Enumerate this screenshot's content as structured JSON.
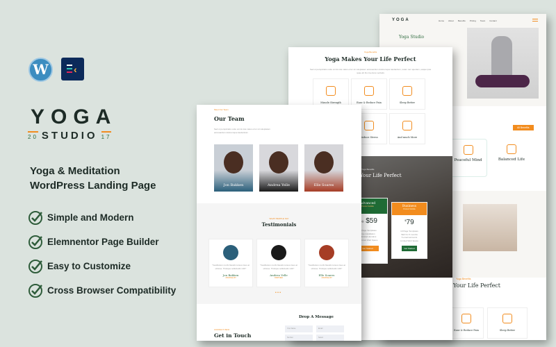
{
  "badges": {
    "wordpress_icon": "wordpress-logo",
    "elementor_icon": "elementor-kit-logo"
  },
  "logo": {
    "word": "YOGA",
    "sub": "STUDIO",
    "left": "20",
    "right": "17"
  },
  "headline": {
    "line1": "Yoga & Meditation",
    "line2": "WordPress Landing Page"
  },
  "features": [
    "Simple and Modern",
    "Elemnentor Page Builder",
    "Easy to Customize",
    "Cross Browser Compatibility"
  ],
  "colors": {
    "accent": "#f28c1e",
    "brand_green": "#2e6b3e",
    "background": "#dbe3de",
    "text_dark": "#1d2b26"
  },
  "back_page": {
    "logo": "YOGA",
    "nav": [
      "Home",
      "About",
      "Benefits",
      "Pricing",
      "Team",
      "Contact"
    ],
    "hero_title": "Yoga Studio",
    "benefits_btn": "All Benefits",
    "cards": [
      {
        "title": "Peaceful Mind"
      },
      {
        "title": "Balanced Life"
      }
    ],
    "section_label": "Yoga Benefits",
    "section_title": "Your Life Perfect",
    "items": [
      "Ease & Reduce Pain",
      "Sleep Better"
    ]
  },
  "middle_page": {
    "label": "Yoga Benefits",
    "title": "Yoga Makes Your Life Perfect",
    "items": [
      "Muscle Strength",
      "Ease & Reduce Pain",
      "Sleep Better",
      "Reduce Stress",
      "And much More"
    ],
    "pricing": {
      "label": "Yoga Benefits",
      "title": "Your Life Perfect",
      "plans": [
        {
          "name": "Advanced",
          "sub": "Product Subtitle",
          "old_price": "$99",
          "price": "59",
          "button": "Get Started"
        },
        {
          "name": "Business",
          "sub": "Product Subtitle",
          "price": "79",
          "currency": "$",
          "button": "Get Started"
        }
      ]
    }
  },
  "front_page": {
    "team_label": "Meet Our Team",
    "team_title": "Our Team",
    "team": [
      {
        "name": "Jon Bakken"
      },
      {
        "name": "Andrea Yelle"
      },
      {
        "name": "Elle Soares"
      }
    ],
    "testimonials_label": "WHAT PEOPLE SAY",
    "testimonials_title": "Testimonials",
    "testimonials": [
      {
        "name": "Jon Bakken",
        "role": "JOURNALIST"
      },
      {
        "name": "Andrea Yelle",
        "role": "PARTNER"
      },
      {
        "name": "Elle Soares",
        "role": "JOURNALIST"
      }
    ],
    "contact_label": "CONTACT INFO",
    "contact_title": "Get in Touch",
    "form_title": "Drop A Message",
    "form": {
      "name": "Your Name",
      "email": "Email",
      "number": "Number",
      "select": "Select"
    }
  }
}
